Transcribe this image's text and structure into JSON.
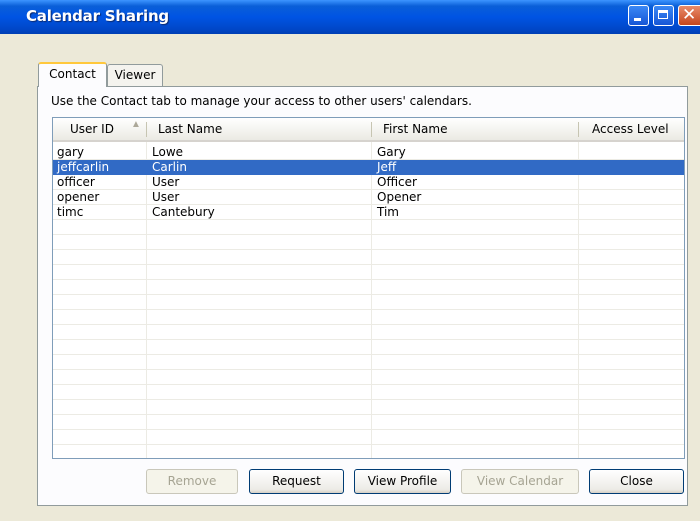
{
  "window": {
    "title": "Calendar Sharing"
  },
  "tabs": [
    {
      "label": "Contact",
      "active": true
    },
    {
      "label": "Viewer",
      "active": false
    }
  ],
  "description": "Use the Contact tab to manage your access to other users' calendars.",
  "table": {
    "columns": [
      "User ID",
      "Last Name",
      "First Name",
      "Access Level"
    ],
    "sort_column": "User ID",
    "rows": [
      {
        "user_id": "gary",
        "last_name": "Lowe",
        "first_name": "Gary",
        "access_level": "",
        "selected": false
      },
      {
        "user_id": "jeffcarlin",
        "last_name": "Carlin",
        "first_name": "Jeff",
        "access_level": "",
        "selected": true
      },
      {
        "user_id": "officer",
        "last_name": "User",
        "first_name": "Officer",
        "access_level": "",
        "selected": false
      },
      {
        "user_id": "opener",
        "last_name": "User",
        "first_name": "Opener",
        "access_level": "",
        "selected": false
      },
      {
        "user_id": "timc",
        "last_name": "Cantebury",
        "first_name": "Tim",
        "access_level": "",
        "selected": false
      }
    ]
  },
  "buttons": {
    "remove": "Remove",
    "request": "Request",
    "view_profile": "View Profile",
    "view_calendar": "View Calendar",
    "close": "Close"
  },
  "colors": {
    "selection": "#316ac5",
    "title_bar": "#0054e3",
    "active_tab_accent": "#ffc83c"
  }
}
